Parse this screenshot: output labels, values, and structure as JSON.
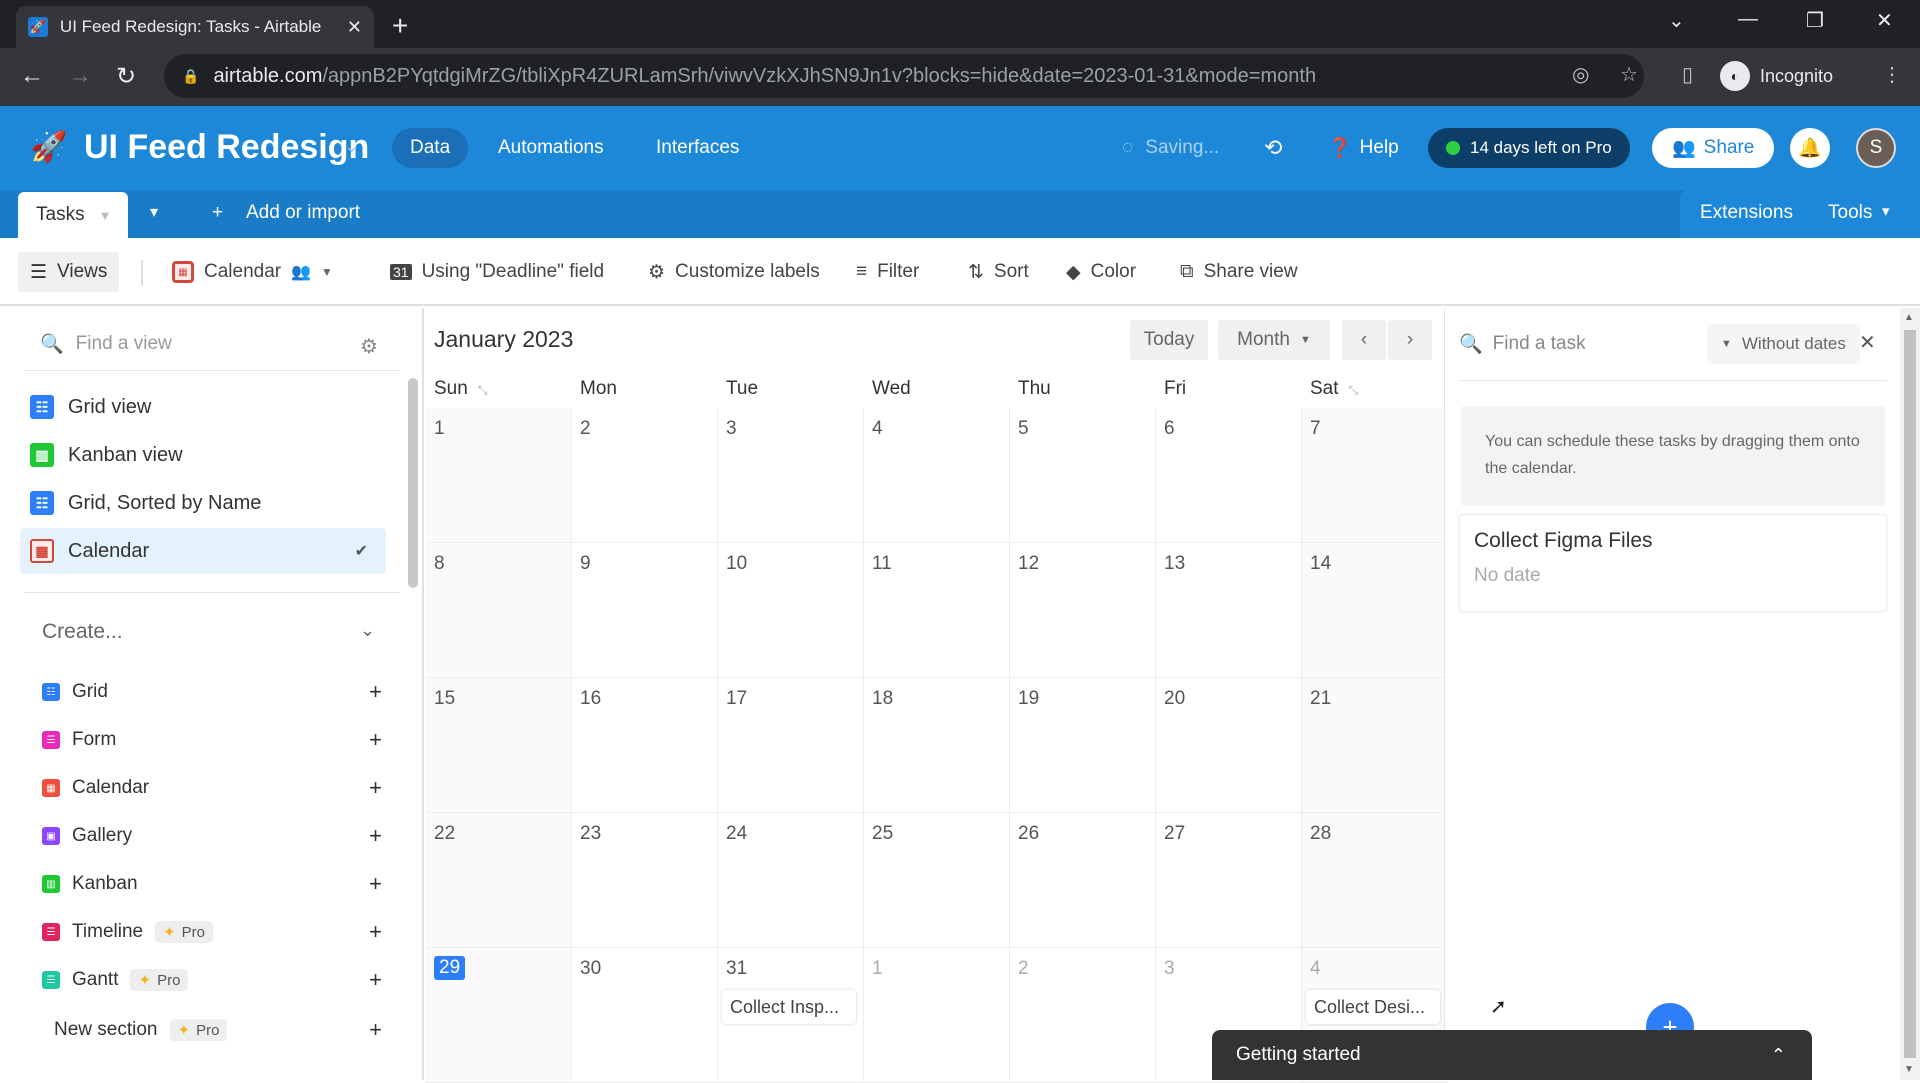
{
  "browser": {
    "tab_title": "UI Feed Redesign: Tasks - Airtable",
    "new_tab": "+",
    "url_host": "airtable.com",
    "url_path": "/appnB2PYqtdgiMrZG/tbliXpR4ZURLamSrh/viwvVzkXJhSN9Jn1v?blocks=hide&date=2023-01-31&mode=month",
    "profile_label": "Incognito"
  },
  "header": {
    "base_name": "UI Feed Redesign",
    "nav": [
      "Data",
      "Automations",
      "Interfaces"
    ],
    "active_nav": "Data",
    "saving": "Saving...",
    "help": "Help",
    "trial": "14 days left on Pro",
    "share": "Share",
    "avatar_initial": "S"
  },
  "tablebar": {
    "active_table": "Tasks",
    "add_label": "Add or import",
    "extensions": "Extensions",
    "tools": "Tools"
  },
  "viewbar": {
    "views": "Views",
    "current_view": "Calendar",
    "date_field": "Using \"Deadline\" field",
    "customize": "Customize labels",
    "filter": "Filter",
    "sort": "Sort",
    "color": "Color",
    "share_view": "Share view"
  },
  "sidebar": {
    "search_placeholder": "Find a view",
    "views": [
      {
        "label": "Grid view",
        "type": "grid"
      },
      {
        "label": "Kanban view",
        "type": "kanban"
      },
      {
        "label": "Grid, Sorted by Name",
        "type": "grid"
      },
      {
        "label": "Calendar",
        "type": "calendar",
        "selected": true
      }
    ],
    "create_label": "Create...",
    "create_items": [
      {
        "label": "Grid",
        "color": "#2d7ff9",
        "pro": false
      },
      {
        "label": "Form",
        "color": "#e929ba",
        "pro": false
      },
      {
        "label": "Calendar",
        "color": "#f82b60",
        "pro": false
      },
      {
        "label": "Gallery",
        "color": "#8b46ff",
        "pro": false
      },
      {
        "label": "Kanban",
        "color": "#20c933",
        "pro": false
      },
      {
        "label": "Timeline",
        "color": "#e0245e",
        "pro": true
      },
      {
        "label": "Gantt",
        "color": "#20c7a0",
        "pro": true
      }
    ],
    "new_section": "New section",
    "pro_label": "Pro"
  },
  "calendar": {
    "month_title": "January 2023",
    "today": "Today",
    "mode": "Month",
    "weekdays": [
      "Sun",
      "Mon",
      "Tue",
      "Wed",
      "Thu",
      "Fri",
      "Sat"
    ],
    "weeks": [
      [
        "1",
        "2",
        "3",
        "4",
        "5",
        "6",
        "7"
      ],
      [
        "8",
        "9",
        "10",
        "11",
        "12",
        "13",
        "14"
      ],
      [
        "15",
        "16",
        "17",
        "18",
        "19",
        "20",
        "21"
      ],
      [
        "22",
        "23",
        "24",
        "25",
        "26",
        "27",
        "28"
      ],
      [
        "29",
        "30",
        "31",
        "1",
        "2",
        "3",
        "4"
      ]
    ],
    "today_date": "29",
    "events": [
      {
        "week": 4,
        "day": 2,
        "label": "Collect Insp..."
      },
      {
        "week": 4,
        "day": 6,
        "label": "Collect Desi..."
      }
    ]
  },
  "task_panel": {
    "search_placeholder": "Find a task",
    "filter": "Without dates",
    "hint": "You can schedule these tasks by dragging them onto the calendar.",
    "cards": [
      {
        "title": "Collect Figma Files",
        "date": "No date"
      }
    ]
  },
  "getting_started": "Getting started"
}
